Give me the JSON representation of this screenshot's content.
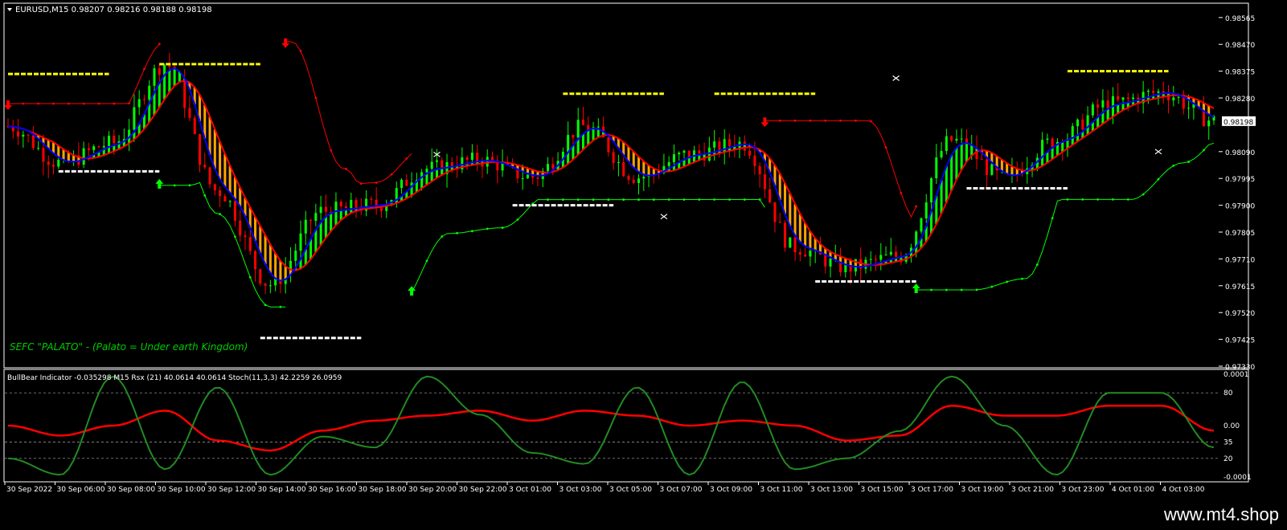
{
  "header": {
    "symbol_line": "EURUSD,M15  0.98207 0.98216 0.98188 0.98198"
  },
  "main_chart": {
    "price_ticks": [
      "0.98565",
      "0.98470",
      "0.98375",
      "0.98280",
      "0.98198",
      "0.98090",
      "0.97995",
      "0.97900",
      "0.97805",
      "0.97710",
      "0.97615",
      "0.97520",
      "0.97425",
      "0.97330"
    ],
    "current_price": "0.98198",
    "annotation": "SEFC \"PALATO\" - (Palato = Under earth Kingdom)",
    "colors": {
      "bull_candle": "#00ff00",
      "bear_candle": "#ff0000",
      "ma_blue": "#0000ff",
      "ma_red": "#ff0000",
      "fill_bull": "#00ff00",
      "fill_bear": "#ffa500",
      "support": "#00ff00",
      "resistance": "#ff0000",
      "level_yellow": "#ffff00",
      "level_white": "#ffffff"
    },
    "icons": {
      "up_arrow": "green-up-arrow-icon",
      "down_arrow": "red-down-arrow-icon",
      "cross": "scissors-cross-icon"
    }
  },
  "indicator": {
    "header": "BullBear Indicator -0.035298  M15  Rsx (21) 40.0614 40.0614  Stoch(11,3,3) 42.2259 26.0959",
    "ticks": [
      "0.0001",
      "80",
      "0.00",
      "35",
      "20",
      "-0.0001"
    ],
    "colors": {
      "bullbear": "#ff0000",
      "stoch": "#228b22"
    }
  },
  "x_axis": {
    "labels": [
      "30 Sep 2022",
      "30 Sep 06:00",
      "30 Sep 08:00",
      "30 Sep 10:00",
      "30 Sep 12:00",
      "30 Sep 14:00",
      "30 Sep 16:00",
      "30 Sep 18:00",
      "30 Sep 20:00",
      "30 Sep 22:00",
      "3 Oct 01:00",
      "3 Oct 03:00",
      "3 Oct 05:00",
      "3 Oct 07:00",
      "3 Oct 09:00",
      "3 Oct 11:00",
      "3 Oct 13:00",
      "3 Oct 15:00",
      "3 Oct 17:00",
      "3 Oct 19:00",
      "3 Oct 21:00",
      "3 Oct 23:00",
      "4 Oct 01:00",
      "4 Oct 03:00"
    ]
  },
  "watermark": "www.mt4.shop",
  "chart_data": {
    "type": "line",
    "symbol": "EURUSD",
    "timeframe": "M15",
    "ylim": [
      0.9733,
      0.9861
    ],
    "x": [
      "30 Sep 2022",
      "30 Sep 06:00",
      "30 Sep 08:00",
      "30 Sep 10:00",
      "30 Sep 12:00",
      "30 Sep 14:00",
      "30 Sep 16:00",
      "30 Sep 18:00",
      "30 Sep 20:00",
      "30 Sep 22:00",
      "3 Oct 01:00",
      "3 Oct 03:00",
      "3 Oct 05:00",
      "3 Oct 07:00",
      "3 Oct 09:00",
      "3 Oct 11:00",
      "3 Oct 13:00",
      "3 Oct 15:00",
      "3 Oct 17:00",
      "3 Oct 19:00",
      "3 Oct 21:00",
      "3 Oct 23:00",
      "4 Oct 01:00",
      "4 Oct 03:00"
    ],
    "price_path": [
      0.9818,
      0.9805,
      0.9812,
      0.984,
      0.9795,
      0.9762,
      0.9788,
      0.979,
      0.9803,
      0.9806,
      0.98,
      0.9818,
      0.98,
      0.9808,
      0.9812,
      0.9775,
      0.9768,
      0.9772,
      0.9813,
      0.98,
      0.9813,
      0.9826,
      0.983,
      0.982
    ],
    "stoch_values": [
      20,
      5,
      95,
      10,
      85,
      5,
      40,
      30,
      95,
      60,
      25,
      15,
      85,
      5,
      90,
      10,
      20,
      45,
      95,
      50,
      5,
      80,
      80,
      30
    ],
    "bullbear_values": [
      0.0,
      -2e-05,
      0.0,
      3e-05,
      -3e-05,
      -5e-05,
      -1e-05,
      1e-05,
      2e-05,
      3e-05,
      1e-05,
      3e-05,
      2e-05,
      0.0,
      1e-05,
      0.0,
      -3e-05,
      -2e-05,
      4e-05,
      2e-05,
      2e-05,
      4e-05,
      4e-05,
      -1e-05
    ]
  }
}
